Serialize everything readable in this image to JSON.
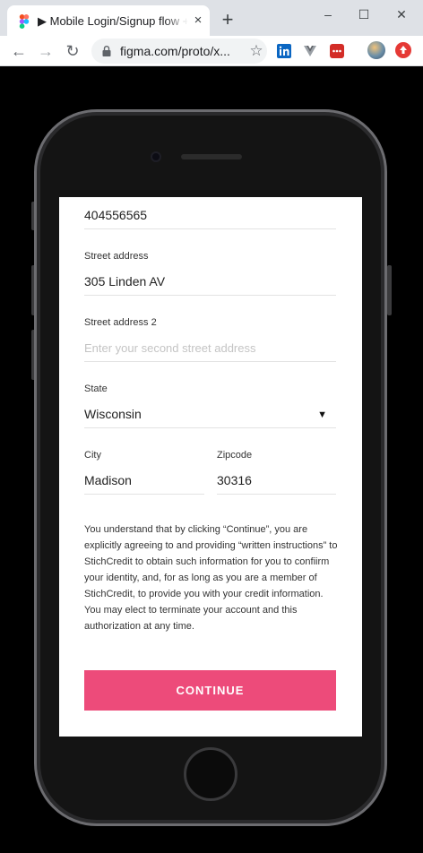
{
  "browser": {
    "tab_title": "▶ Mobile Login/Signup flow + A",
    "tab_close": "×",
    "new_tab": "+",
    "minimize": "–",
    "maximize": "☐",
    "close": "✕",
    "back": "←",
    "forward": "→",
    "reload": "↻",
    "url": "figma.com/proto/x...",
    "bookmark": "☆",
    "extensions": [
      "linkedin-icon",
      "vuejs-devtools-icon",
      "lastpass-icon",
      "profile-avatar",
      "update-icon"
    ]
  },
  "form": {
    "phone_value": "404556565",
    "street_address": {
      "label": "Street address",
      "value": "305 Linden AV"
    },
    "street_address_2": {
      "label": "Street address 2",
      "placeholder": "Enter your second street address"
    },
    "state": {
      "label": "State",
      "value": "Wisconsin",
      "caret": "▼"
    },
    "city": {
      "label": "City",
      "value": "Madison"
    },
    "zipcode": {
      "label": "Zipcode",
      "value": "30316"
    },
    "disclaimer": "You understand that by clicking “Continue”, you are explicitly agreeing to and providing “written instructions” to StichCredit to obtain such information for you to confiirm your identity, and, for as long as you are a member of StichCredit, to provide you with your credit information. You may elect to terminate your account and this authorization at any time.",
    "continue_label": "CONTINUE"
  },
  "colors": {
    "accent": "#ed4b7a",
    "browser_chrome": "#dee1e6",
    "page_background": "#000000"
  }
}
